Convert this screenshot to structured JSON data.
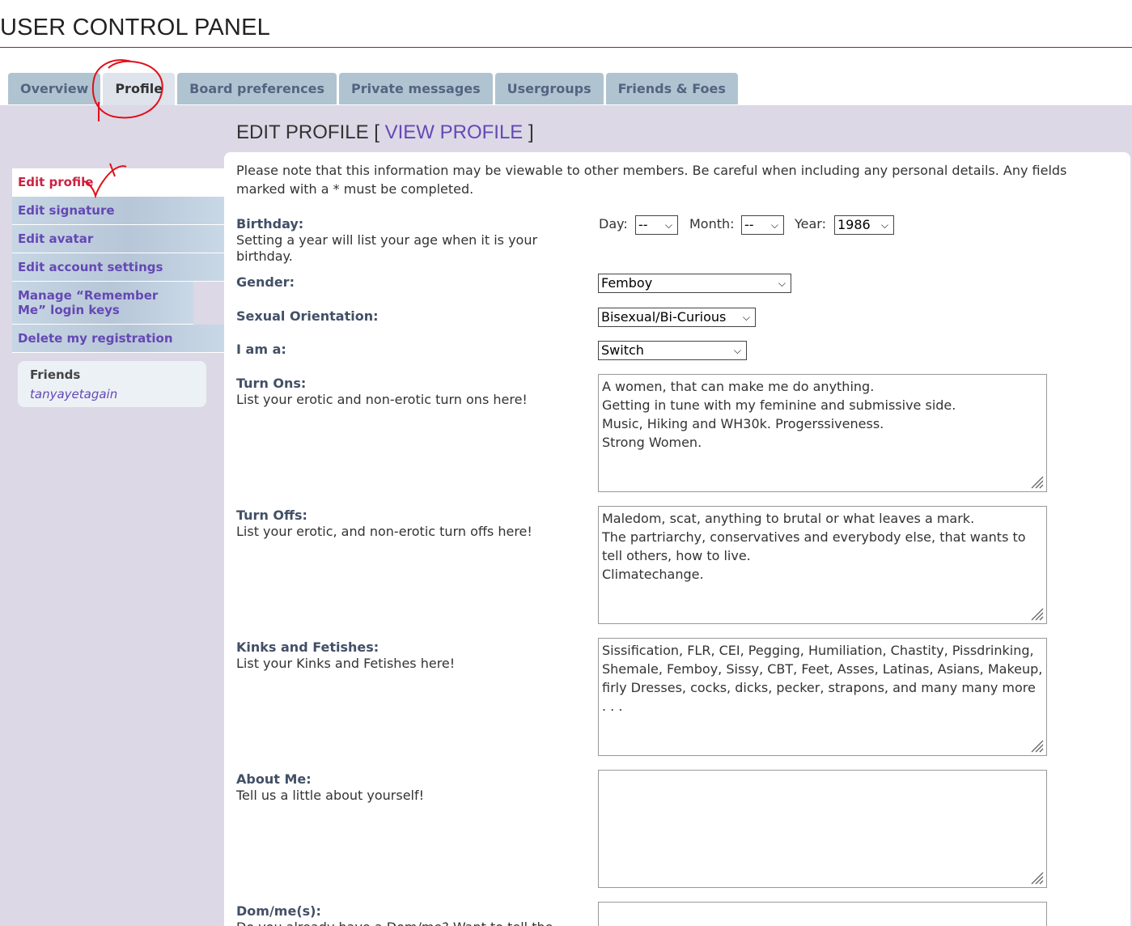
{
  "page_title": "USER CONTROL PANEL",
  "tabs": [
    {
      "label": "Overview"
    },
    {
      "label": "Profile"
    },
    {
      "label": "Board preferences"
    },
    {
      "label": "Private messages"
    },
    {
      "label": "Usergroups"
    },
    {
      "label": "Friends & Foes"
    }
  ],
  "heading": {
    "main": "EDIT PROFILE",
    "bracket_open": "[",
    "link": "VIEW PROFILE",
    "bracket_close": "]"
  },
  "sidebar": {
    "items": [
      {
        "label": "Edit profile"
      },
      {
        "label": "Edit signature"
      },
      {
        "label": "Edit avatar"
      },
      {
        "label": "Edit account settings"
      },
      {
        "label": "Manage “Remember Me” login keys"
      },
      {
        "label": "Delete my registration"
      }
    ],
    "friends_title": "Friends",
    "friend": "tanyayetagain"
  },
  "notice": "Please note that this information may be viewable to other members. Be careful when including any personal details. Any fields marked with a * must be completed.",
  "birthday": {
    "label": "Birthday:",
    "explain": "Setting a year will list your age when it is your birthday.",
    "day_label": "Day:",
    "day_value": "--",
    "month_label": "Month:",
    "month_value": "--",
    "year_label": "Year:",
    "year_value": "1986"
  },
  "gender": {
    "label": "Gender:",
    "value": "Femboy"
  },
  "orientation": {
    "label": "Sexual Orientation:",
    "value": "Bisexual/Bi-Curious"
  },
  "iam": {
    "label": "I am a:",
    "value": "Switch"
  },
  "turn_ons": {
    "label": "Turn Ons:",
    "explain": "List your erotic and non-erotic turn ons here!",
    "value": "A women, that can make me do anything.\nGetting in tune with my feminine and submissive side.\nMusic, Hiking and WH30k. Progerssiveness.\nStrong Women."
  },
  "turn_offs": {
    "label": "Turn Offs:",
    "explain": "List your erotic, and non-erotic turn offs here!",
    "value": "Maledom, scat, anything to brutal or what leaves a mark.\nThe partriarchy, conservatives and everybody else, that wants to tell others, how to live.\nClimatechange."
  },
  "kinks": {
    "label": "Kinks and Fetishes:",
    "explain": "List your Kinks and Fetishes here!",
    "value": "Sissification, FLR, CEI, Pegging, Humiliation, Chastity, Pissdrinking, Shemale, Femboy, Sissy, CBT, Feet, Asses, Latinas, Asians, Makeup, firly Dresses, cocks, dicks, pecker, strapons, and many many more . . ."
  },
  "about": {
    "label": "About Me:",
    "explain": "Tell us a little about yourself!",
    "value": ""
  },
  "domme": {
    "label": "Dom/me(s):",
    "explain": "Do you already have a Dom/me? Want to tell the"
  },
  "colors": {
    "accent_link": "#6448b4",
    "active_red": "#cc2244",
    "panel_bg": "#dcd8e6",
    "tab_bg": "#b0c3d0"
  }
}
